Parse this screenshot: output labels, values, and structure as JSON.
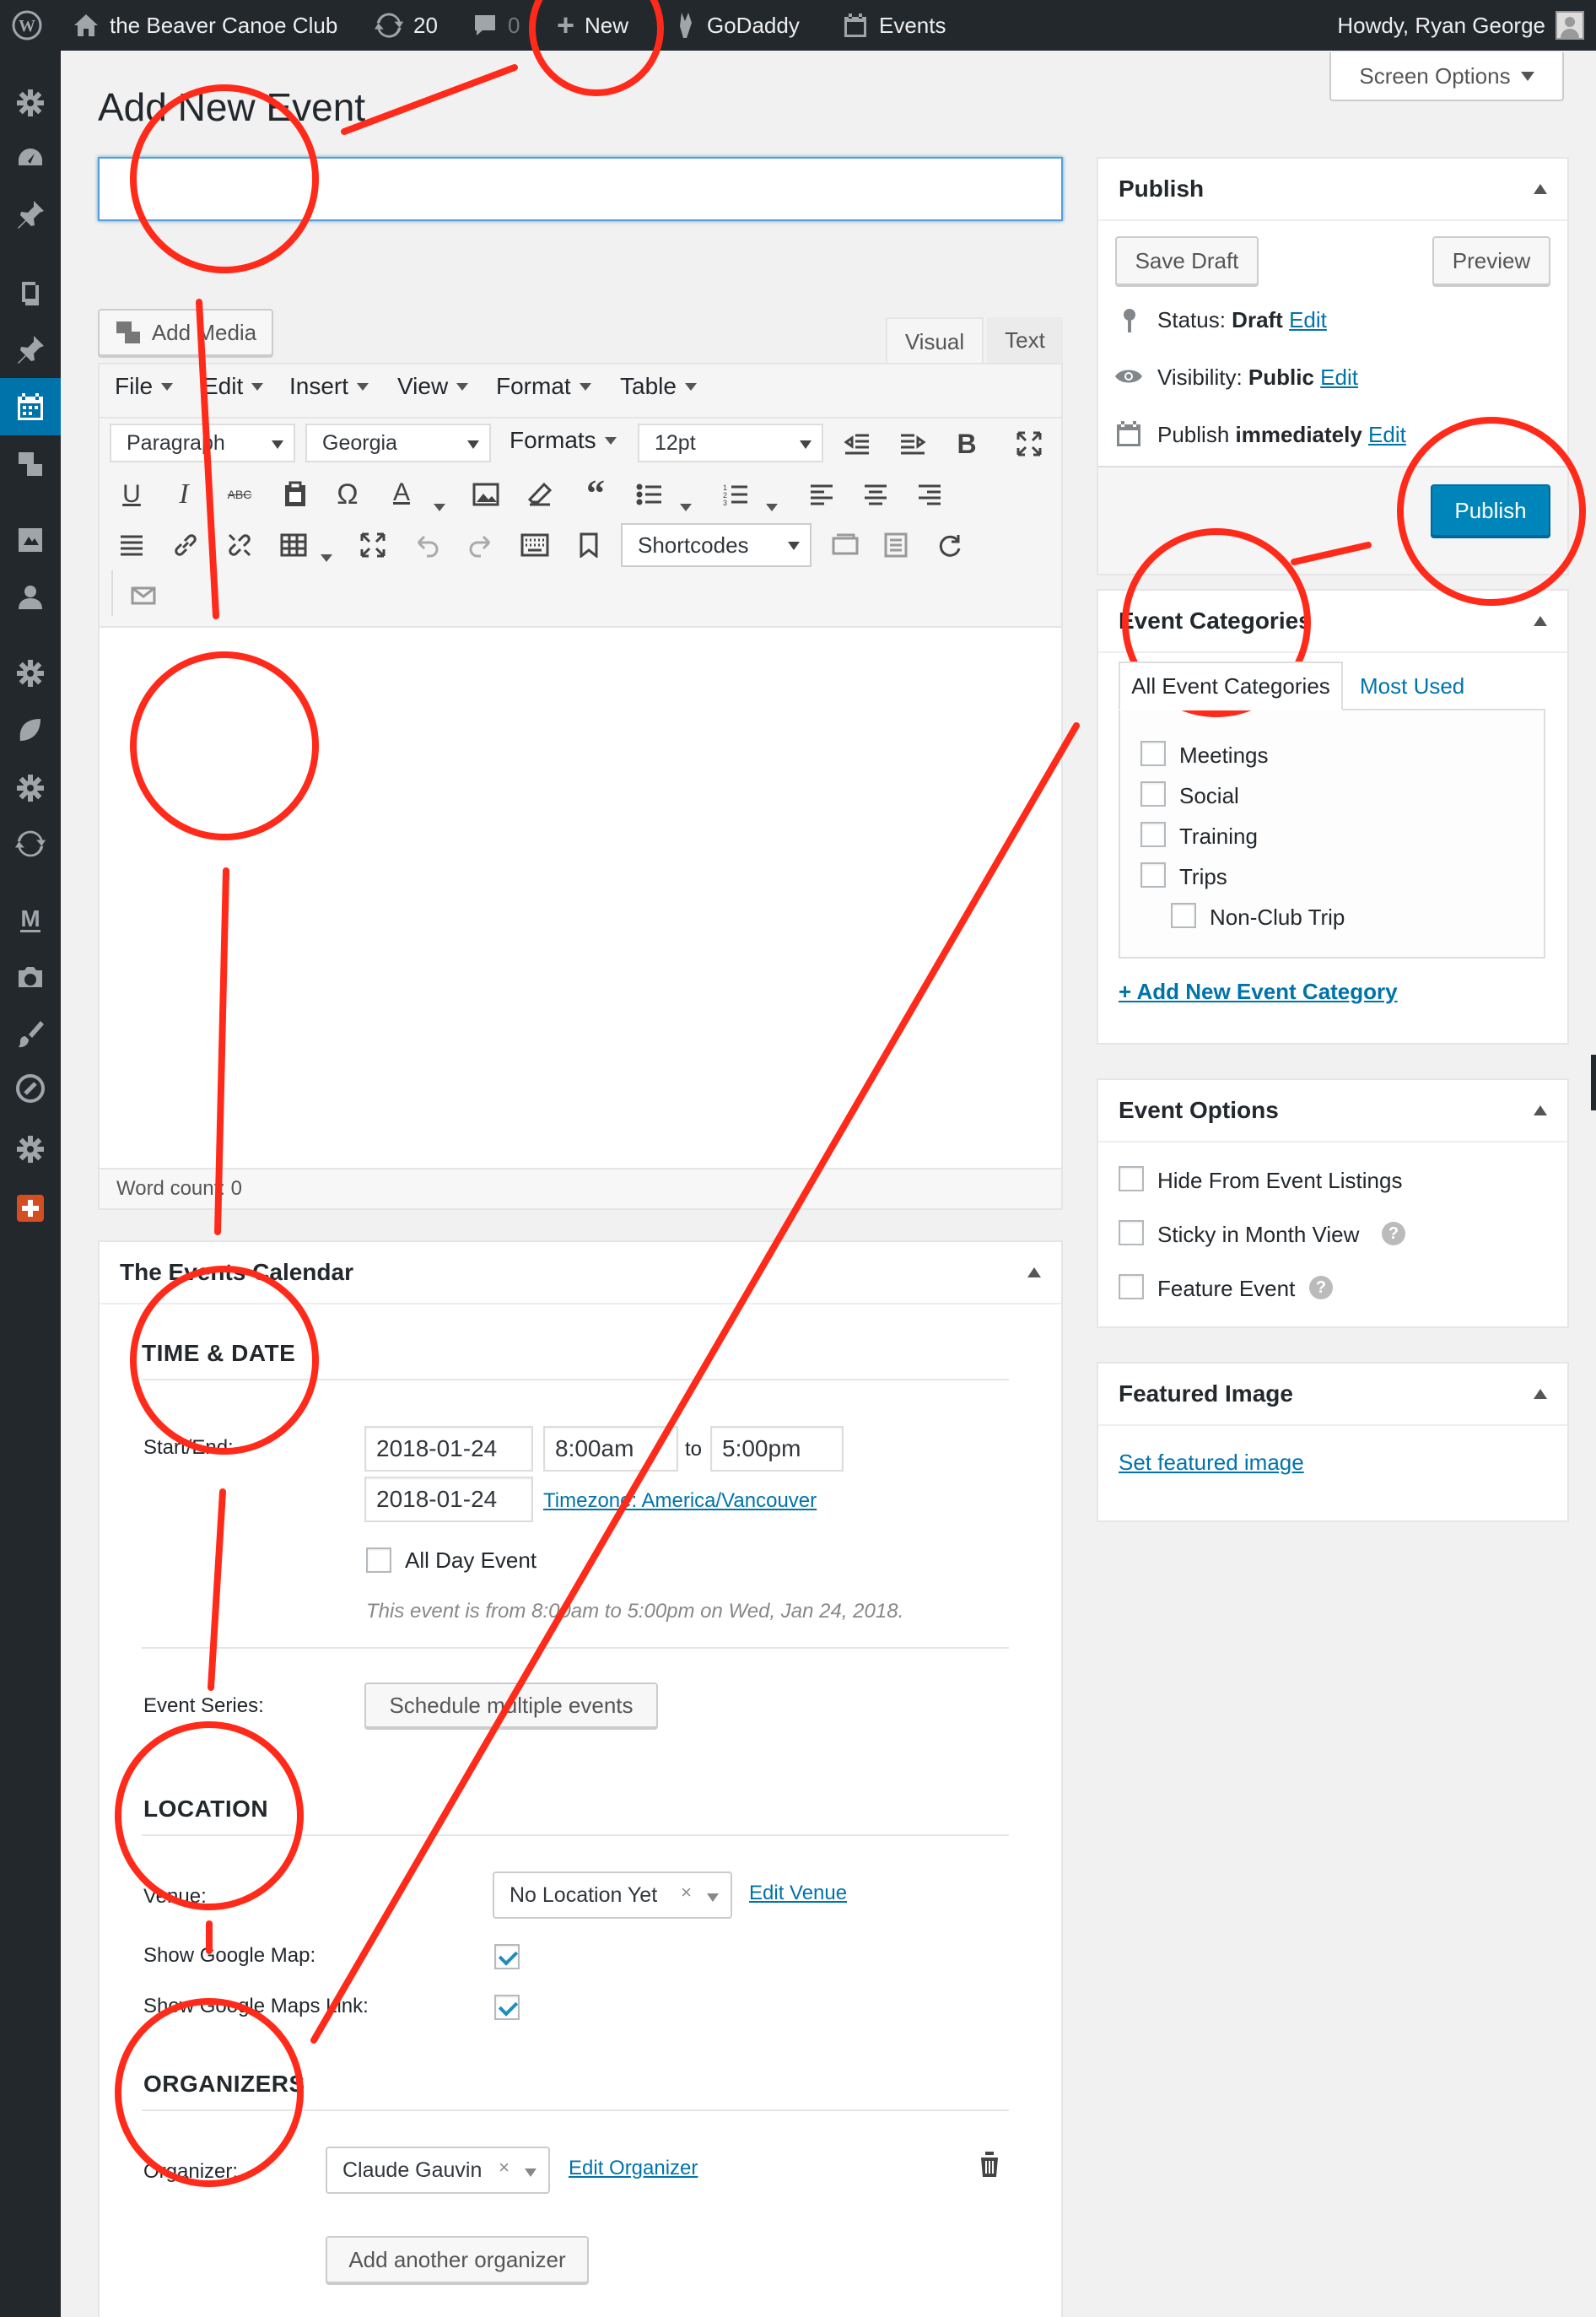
{
  "adminbar": {
    "site_name": "the Beaver Canoe Club",
    "updates_count": "20",
    "comments_count": "0",
    "new_label": "New",
    "godaddy_label": "GoDaddy",
    "events_label": "Events",
    "howdy": "Howdy, Ryan George"
  },
  "screen_options": "Screen Options",
  "page_title": "Add New Event",
  "editor": {
    "add_media": "Add Media",
    "tab_visual": "Visual",
    "tab_text": "Text",
    "menus": [
      "File",
      "Edit",
      "Insert",
      "View",
      "Format",
      "Table"
    ],
    "paragraph_select": "Paragraph",
    "font_select": "Georgia",
    "formats_label": "Formats",
    "size_select": "12pt",
    "shortcodes_select": "Shortcodes",
    "word_count": "Word count: 0"
  },
  "events_calendar": {
    "box_title": "The Events Calendar",
    "time_date_heading": "TIME & DATE",
    "start_end_label": "Start/End:",
    "start_date": "2018-01-24",
    "start_time": "8:00am",
    "to_label": "to",
    "end_time": "5:00pm",
    "end_date": "2018-01-24",
    "timezone_link": "Timezone: America/Vancouver",
    "all_day_label": "All Day Event",
    "summary": "This event is from 8:00am to 5:00pm on Wed, Jan 24, 2018.",
    "event_series_label": "Event Series:",
    "schedule_button": "Schedule multiple events",
    "location_heading": "LOCATION",
    "venue_label": "Venue:",
    "venue_value": "No Location Yet",
    "edit_venue": "Edit Venue",
    "show_map_label": "Show Google Map:",
    "show_map_link_label": "Show Google Maps Link:",
    "organizers_heading": "ORGANIZERS",
    "organizer_label": "Organizer:",
    "organizer_value": "Claude Gauvin",
    "edit_organizer": "Edit Organizer",
    "add_organizer_button": "Add another organizer"
  },
  "publish": {
    "title": "Publish",
    "save_draft": "Save Draft",
    "preview": "Preview",
    "status_label": "Status:",
    "status_value": "Draft",
    "visibility_label": "Visibility:",
    "visibility_value": "Public",
    "publish_label": "Publish",
    "publish_value": "immediately",
    "edit": "Edit",
    "publish_button": "Publish"
  },
  "categories": {
    "title": "Event Categories",
    "tab_all": "All Event Categories",
    "tab_most_used": "Most Used",
    "items": [
      "Meetings",
      "Social",
      "Training",
      "Trips",
      "Non-Club Trip"
    ],
    "add_new": "+ Add New Event Category"
  },
  "event_options": {
    "title": "Event Options",
    "items": [
      "Hide From Event Listings",
      "Sticky in Month View",
      "Feature Event"
    ]
  },
  "featured_image": {
    "title": "Featured Image",
    "link": "Set featured image"
  },
  "annotation_color": "#ff2a1a"
}
